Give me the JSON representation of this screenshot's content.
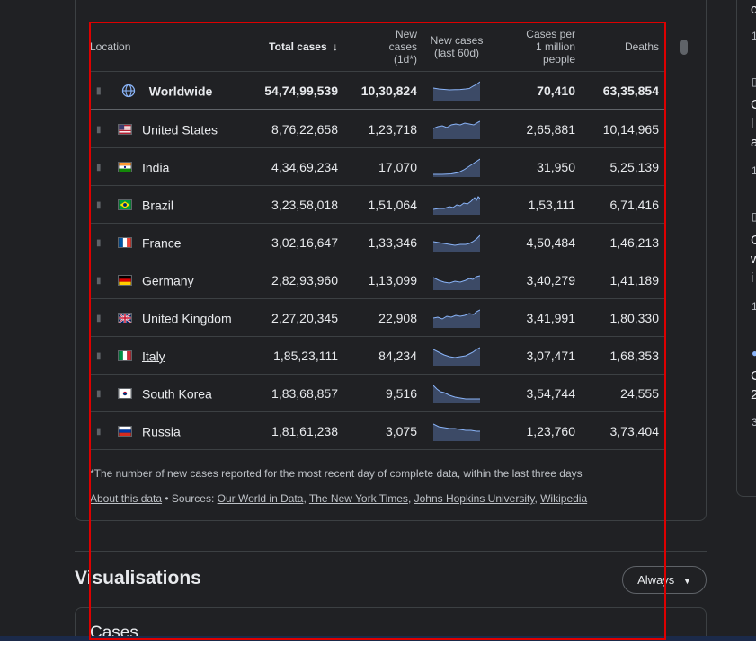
{
  "table": {
    "headers": {
      "location": "Location",
      "total_cases": "Total cases",
      "new_cases_1": "New",
      "new_cases_2": "cases",
      "new_cases_3": "(1d*)",
      "new_60d_1": "New cases",
      "new_60d_2": "(last 60d)",
      "per_million_1": "Cases per",
      "per_million_2": "1 million",
      "per_million_3": "people",
      "deaths": "Deaths"
    },
    "sort_icon": "arrow-down-icon",
    "worldwide": {
      "name": "Worldwide",
      "total": "54,74,99,539",
      "new": "10,30,824",
      "per_million": "70,410",
      "deaths": "63,35,854",
      "icon": "globe-icon"
    },
    "rows": [
      {
        "name": "United States",
        "total": "8,76,22,658",
        "new": "1,23,718",
        "per_million": "2,65,881",
        "deaths": "10,14,965",
        "flag": "us-flag-icon",
        "link": false
      },
      {
        "name": "India",
        "total": "4,34,69,234",
        "new": "17,070",
        "per_million": "31,950",
        "deaths": "5,25,139",
        "flag": "india-flag-icon",
        "link": false
      },
      {
        "name": "Brazil",
        "total": "3,23,58,018",
        "new": "1,51,064",
        "per_million": "1,53,111",
        "deaths": "6,71,416",
        "flag": "brazil-flag-icon",
        "link": false
      },
      {
        "name": "France",
        "total": "3,02,16,647",
        "new": "1,33,346",
        "per_million": "4,50,484",
        "deaths": "1,46,213",
        "flag": "france-flag-icon",
        "link": false
      },
      {
        "name": "Germany",
        "total": "2,82,93,960",
        "new": "1,13,099",
        "per_million": "3,40,279",
        "deaths": "1,41,189",
        "flag": "germany-flag-icon",
        "link": false
      },
      {
        "name": "United Kingdom",
        "total": "2,27,20,345",
        "new": "22,908",
        "per_million": "3,41,991",
        "deaths": "1,80,330",
        "flag": "uk-flag-icon",
        "link": false
      },
      {
        "name": "Italy",
        "total": "1,85,23,111",
        "new": "84,234",
        "per_million": "3,07,471",
        "deaths": "1,68,353",
        "flag": "italy-flag-icon",
        "link": true
      },
      {
        "name": "South Korea",
        "total": "1,83,68,857",
        "new": "9,516",
        "per_million": "3,54,744",
        "deaths": "24,555",
        "flag": "south-korea-flag-icon",
        "link": false
      },
      {
        "name": "Russia",
        "total": "1,81,61,238",
        "new": "3,075",
        "per_million": "1,23,760",
        "deaths": "3,73,404",
        "flag": "russia-flag-icon",
        "link": false
      }
    ]
  },
  "footnote": "*The number of new cases reported for the most recent day of complete data, within the last three days",
  "sources": {
    "about": "About this data",
    "bullet": " • Sources: ",
    "owid": "Our World in Data",
    "nyt": "The New York Times",
    "jhu": "Johns Hopkins University",
    "wiki": "Wikipedia",
    "sep": ", "
  },
  "visualisations": {
    "title": "Visualisations",
    "dropdown": "Always",
    "cases_title": "Cases"
  },
  "right_panel": {
    "t1": "c",
    "t2": "1",
    "t3": "C",
    "t4": "l",
    "t5": "a",
    "t6": "1",
    "t7": "C",
    "t8": "w",
    "t9": "i",
    "t10": "1",
    "t11": "C",
    "t12": "2",
    "t13": "3"
  },
  "colors": {
    "background": "#202124",
    "border": "#3c4043",
    "spark_fill": "#3c4a66",
    "spark_stroke": "#8ab4f8",
    "highlight": "#dd0000"
  }
}
